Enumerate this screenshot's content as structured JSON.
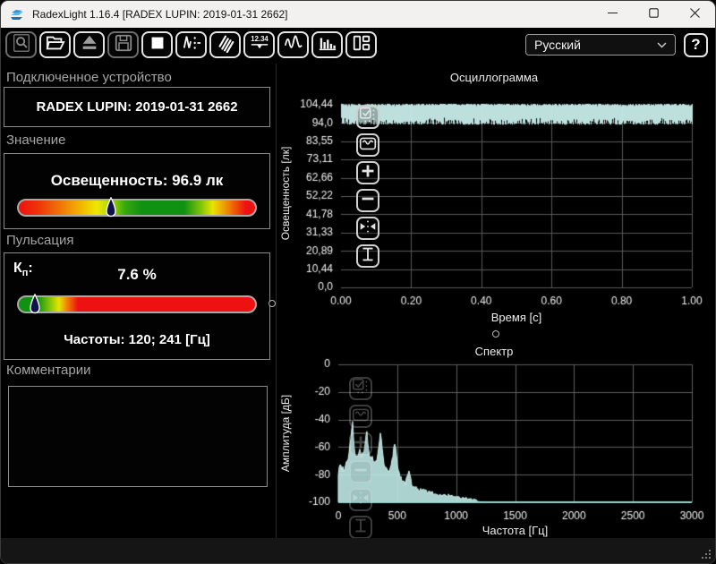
{
  "window": {
    "title": "RadexLight 1.16.4 [RADEX LUPIN: 2019-01-31 2662]",
    "controls": [
      "minimize",
      "maximize",
      "close"
    ]
  },
  "toolbar": {
    "buttons": [
      {
        "name": "search",
        "icon": "magnifier-icon",
        "disabled": true
      },
      {
        "name": "open-file",
        "icon": "open-folder-icon",
        "disabled": false
      },
      {
        "name": "read-device",
        "icon": "eject-icon",
        "disabled": false,
        "dim_glyph": true
      },
      {
        "name": "save",
        "icon": "floppy-icon",
        "disabled": true
      },
      {
        "name": "stop",
        "icon": "stop-icon",
        "disabled": false
      },
      {
        "name": "record-settings",
        "icon": "waveform-dots-icon",
        "disabled": false
      },
      {
        "name": "sensor",
        "icon": "stripes-icon",
        "disabled": false
      },
      {
        "name": "digital-display",
        "icon": "digital-display-icon",
        "disabled": false,
        "label": "12.34"
      },
      {
        "name": "oscillogram-view",
        "icon": "line-chart-icon",
        "disabled": false
      },
      {
        "name": "spectrum-view",
        "icon": "bar-chart-icon",
        "disabled": false
      },
      {
        "name": "layout",
        "icon": "layout-icon",
        "disabled": false
      }
    ],
    "language_select": {
      "value": "Русский"
    },
    "help_label": "?"
  },
  "left_panel": {
    "device_section": {
      "label": "Подключенное устройство",
      "device_name": "RADEX LUPIN: 2019-01-31 2662"
    },
    "value_section": {
      "label": "Значение",
      "reading": "Освещенность: 96.9 лк",
      "marker_percent": 39
    },
    "pulsation_section": {
      "label": "Пульсация",
      "kp_main": "К",
      "kp_sub": "п",
      "kp_colon": ":",
      "kp_value": "7.6 %",
      "frequencies": "Частоты: 120; 241 [Гц]",
      "marker_percent": 7
    },
    "comments_section": {
      "label": "Комментарии",
      "text": ""
    }
  },
  "chart_overlay_buttons": [
    "select",
    "autoscale",
    "zoom-in",
    "zoom-out",
    "fit-horizontal",
    "fit-vertical"
  ],
  "chart_data": [
    {
      "type": "line",
      "title": "Осциллограмма",
      "xlabel": "Время [с]",
      "ylabel": "Освещенность [лк]",
      "x_range": [
        0,
        1
      ],
      "y_range": [
        0,
        107.5
      ],
      "x_ticks": [
        {
          "label": "0.00",
          "v": 0
        },
        {
          "label": "0.20",
          "v": 0.2
        },
        {
          "label": "0.40",
          "v": 0.4
        },
        {
          "label": "0.60",
          "v": 0.6
        },
        {
          "label": "0.80",
          "v": 0.8
        },
        {
          "label": "1.00",
          "v": 1.0
        }
      ],
      "y_ticks": [
        {
          "label": "104,44",
          "v": 104.44
        },
        {
          "label": "94,0",
          "v": 93.99
        },
        {
          "label": "83,55",
          "v": 83.55
        },
        {
          "label": "73,11",
          "v": 73.11
        },
        {
          "label": "62,66",
          "v": 62.66
        },
        {
          "label": "52,22",
          "v": 52.22
        },
        {
          "label": "41,78",
          "v": 41.78
        },
        {
          "label": "31,33",
          "v": 31.33
        },
        {
          "label": "20,89",
          "v": 20.89
        },
        {
          "label": "10,44",
          "v": 10.44
        },
        {
          "label": "0,0",
          "v": 0
        }
      ],
      "band": {
        "top_max": 105.0,
        "top_min": 103.6,
        "bottom_min": 93.0,
        "bottom_max": 97.5
      },
      "mean_lux": 96.9,
      "color": "#c7ece9",
      "grid_color": "#5a5a5a",
      "grid": true
    },
    {
      "type": "area",
      "title": "Спектр",
      "xlabel": "Частота [Гц]",
      "ylabel": "Амплитуда [дБ]",
      "x_range": [
        0,
        3000
      ],
      "y_range": [
        -100,
        0
      ],
      "x_ticks": [
        {
          "label": "0",
          "v": 0
        },
        {
          "label": "500",
          "v": 500
        },
        {
          "label": "1000",
          "v": 1000
        },
        {
          "label": "1500",
          "v": 1500
        },
        {
          "label": "2000",
          "v": 2000
        },
        {
          "label": "2500",
          "v": 2500
        },
        {
          "label": "3000",
          "v": 3000
        }
      ],
      "y_ticks": [
        {
          "label": "0",
          "v": 0
        },
        {
          "label": "-20",
          "v": -20
        },
        {
          "label": "-40",
          "v": -40
        },
        {
          "label": "-60",
          "v": -60
        },
        {
          "label": "-80",
          "v": -80
        },
        {
          "label": "-100",
          "v": -100
        }
      ],
      "envelope": [
        [
          0,
          -79
        ],
        [
          15,
          -73
        ],
        [
          35,
          -76
        ],
        [
          55,
          -74
        ],
        [
          75,
          -70
        ],
        [
          95,
          -62
        ],
        [
          110,
          -50
        ],
        [
          118,
          -40
        ],
        [
          120,
          -38
        ],
        [
          123,
          -44
        ],
        [
          130,
          -56
        ],
        [
          140,
          -64
        ],
        [
          155,
          -68
        ],
        [
          170,
          -66
        ],
        [
          185,
          -63
        ],
        [
          200,
          -67
        ],
        [
          215,
          -64
        ],
        [
          228,
          -58
        ],
        [
          236,
          -50
        ],
        [
          241,
          -45
        ],
        [
          247,
          -53
        ],
        [
          258,
          -63
        ],
        [
          270,
          -69
        ],
        [
          285,
          -67
        ],
        [
          300,
          -71
        ],
        [
          315,
          -72
        ],
        [
          330,
          -68
        ],
        [
          345,
          -60
        ],
        [
          355,
          -50
        ],
        [
          360,
          -46
        ],
        [
          367,
          -55
        ],
        [
          375,
          -65
        ],
        [
          385,
          -72
        ],
        [
          400,
          -75
        ],
        [
          415,
          -77
        ],
        [
          430,
          -78
        ],
        [
          445,
          -75
        ],
        [
          460,
          -68
        ],
        [
          472,
          -60
        ],
        [
          481,
          -55
        ],
        [
          490,
          -63
        ],
        [
          500,
          -72
        ],
        [
          515,
          -79
        ],
        [
          530,
          -82
        ],
        [
          550,
          -85
        ],
        [
          570,
          -86
        ],
        [
          585,
          -82
        ],
        [
          597,
          -76
        ],
        [
          605,
          -80
        ],
        [
          620,
          -86
        ],
        [
          640,
          -89
        ],
        [
          670,
          -90
        ],
        [
          700,
          -91
        ],
        [
          740,
          -92
        ],
        [
          780,
          -93
        ],
        [
          830,
          -94
        ],
        [
          880,
          -95
        ],
        [
          930,
          -95
        ],
        [
          980,
          -96
        ],
        [
          1030,
          -97
        ],
        [
          1080,
          -97
        ],
        [
          1130,
          -98
        ],
        [
          1180,
          -99
        ],
        [
          1240,
          -100
        ],
        [
          3000,
          -100
        ]
      ],
      "color": "#c7ece9",
      "grid_color": "#5f5f5f",
      "grid": true
    }
  ],
  "colors": {
    "wave": "#c7ece9",
    "grid": "#5a5a5a",
    "panel_border": "#8b8b8b",
    "label_gray": "#a6a6a6",
    "ok_green": "#119111",
    "warn_yellow": "#e8e400",
    "alarm_red": "#ee1111"
  }
}
